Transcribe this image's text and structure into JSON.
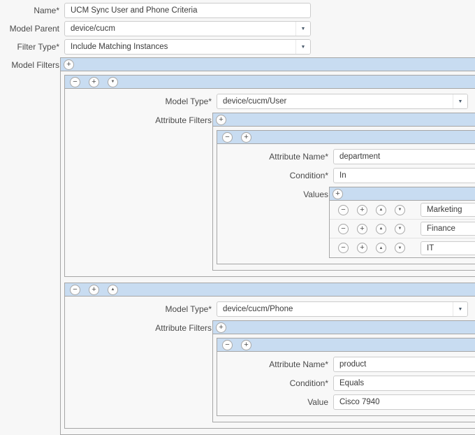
{
  "icons": {
    "add": "+",
    "remove": "−",
    "move_up": "▲",
    "move_down": "▼",
    "dropdown": "▼"
  },
  "colors": {
    "bar_blue": "#c8dcf1",
    "border_gray": "#a6a6a6",
    "background": "#f7f7f7"
  },
  "form": {
    "name": {
      "label": "Name*",
      "value": "UCM Sync User and Phone Criteria"
    },
    "model_parent": {
      "label": "Model Parent",
      "value": "device/cucm"
    },
    "filter_type": {
      "label": "Filter Type*",
      "value": "Include Matching Instances"
    },
    "model_filters": {
      "label": "Model Filters",
      "panels": [
        {
          "model_type": {
            "label": "Model Type*",
            "value": "device/cucm/User"
          },
          "attribute_filters": {
            "label": "Attribute Filters",
            "filters": [
              {
                "attribute_name": {
                  "label": "Attribute Name*",
                  "value": "department"
                },
                "condition": {
                  "label": "Condition*",
                  "value": "In"
                },
                "values": {
                  "label": "Values",
                  "items": [
                    "Marketing",
                    "Finance",
                    "IT"
                  ]
                }
              }
            ]
          }
        },
        {
          "model_type": {
            "label": "Model Type*",
            "value": "device/cucm/Phone"
          },
          "attribute_filters": {
            "label": "Attribute Filters",
            "filters": [
              {
                "attribute_name": {
                  "label": "Attribute Name*",
                  "value": "product"
                },
                "condition": {
                  "label": "Condition*",
                  "value": "Equals"
                },
                "value": {
                  "label": "Value",
                  "value": "Cisco 7940"
                }
              }
            ]
          }
        }
      ]
    }
  }
}
